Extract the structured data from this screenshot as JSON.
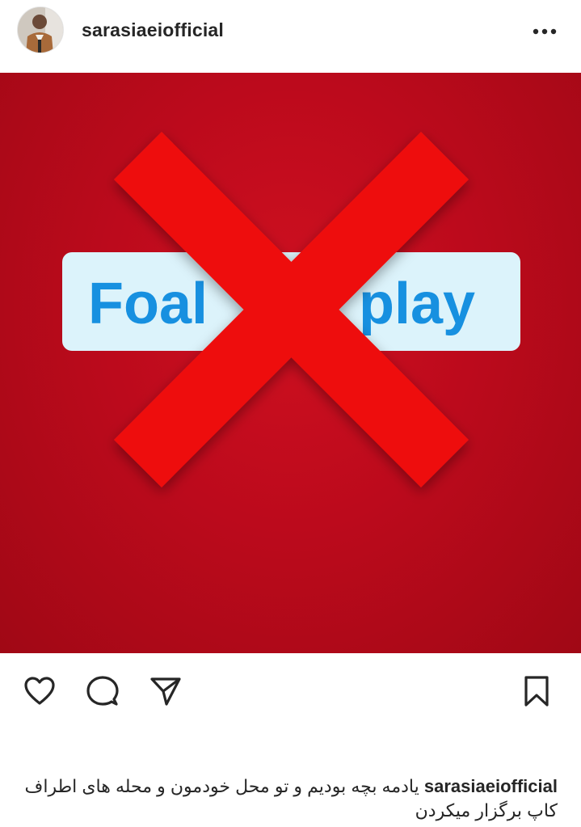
{
  "post": {
    "username": "sarasiaeiofficial",
    "avatar_icon": "profile-photo-avatar",
    "more_icon": "more-horizontal-icon",
    "image": {
      "label_left": "Foal",
      "label_right": "play",
      "x_mark_color": "#ee1111",
      "background_color": "#c00a1c",
      "label_box_color": "#dcf3fb",
      "label_text_color": "#1790e0"
    },
    "actions": {
      "like_icon": "heart-icon",
      "comment_icon": "comment-bubble-icon",
      "share_icon": "send-paper-plane-icon",
      "save_icon": "bookmark-icon"
    },
    "caption": {
      "username": "sarasiaeiofficial",
      "text": "یادمه بچه بودیم و تو محل خودمون و محله های اطراف کاپ برگزار میکردن"
    }
  }
}
